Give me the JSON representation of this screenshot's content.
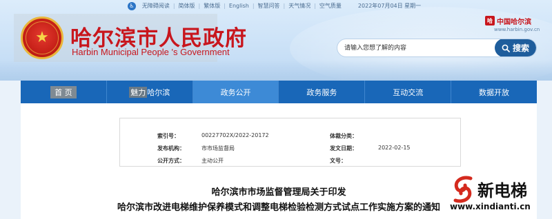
{
  "topbar": {
    "items": [
      "无障碍阅读",
      "简体版",
      "繁体版",
      "English",
      "智慧问答",
      "天气情况",
      "空气质量"
    ],
    "date": "2022年07月04日 星期一"
  },
  "header": {
    "title": "哈尔滨市人民政府",
    "subtitle": "Harbin Municipal People 's Government",
    "logo_text": "中国哈尔滨",
    "logo_url": "www.harbin.gov.cn"
  },
  "search": {
    "placeholder": "请输入您想了解的内容",
    "button_label": "搜索"
  },
  "nav": {
    "items": [
      {
        "label_prefix": "",
        "label_hl": "首 页",
        "label_rest": ""
      },
      {
        "label_prefix": "",
        "label_hl": "魅力",
        "label_rest": "哈尔滨"
      },
      {
        "label_prefix": "政务公开",
        "label_hl": "",
        "label_rest": ""
      },
      {
        "label_prefix": "政务服务",
        "label_hl": "",
        "label_rest": ""
      },
      {
        "label_prefix": "互动交流",
        "label_hl": "",
        "label_rest": ""
      },
      {
        "label_prefix": "数据开放",
        "label_hl": "",
        "label_rest": ""
      }
    ],
    "active_index": 2
  },
  "info": {
    "index_label": "索引号：",
    "index_value": "00227702X/2022-20172",
    "category_label": "体裁分类：",
    "category_value": "",
    "org_label": "发布机构：",
    "org_value": "市市场监督局",
    "date_label": "发文日期：",
    "date_value": "2022-02-15",
    "open_label": "公开方式：",
    "open_value": "主动公开",
    "docno_label": "文号：",
    "docno_value": ""
  },
  "document": {
    "title_line1": "哈尔滨市市场监督管理局关于印发",
    "title_line2": "哈尔滨市改进电梯维护保养模式和调整电梯检验检测方式试点工作实施方案的通知"
  },
  "watermark": {
    "text": "新电梯",
    "url": "www.xindianti.cn"
  },
  "colors": {
    "nav_bg": "#1967b8",
    "nav_active": "#3d8ad6",
    "title_red": "#c8161d",
    "search_btn": "#1e5d9c"
  }
}
